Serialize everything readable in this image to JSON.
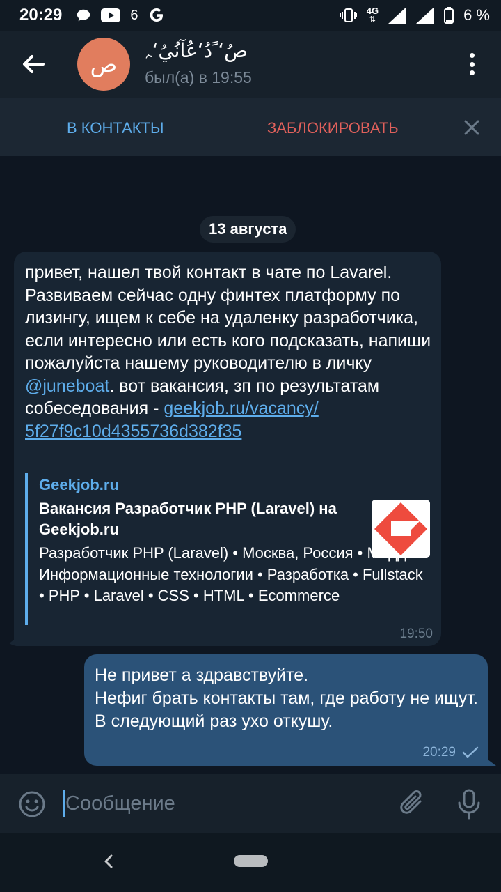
{
  "status_bar": {
    "time": "20:29",
    "notif_count": "6",
    "network": "4G",
    "battery_pct": "6 %",
    "icons": [
      "message-icon",
      "youtube-icon",
      "google-icon",
      "vibrate-icon",
      "signal-icon",
      "battery-icon"
    ]
  },
  "header": {
    "avatar_letter": "ص",
    "contact_name": "صُ‘ﹰدُ‘عُآنُيُ‘ﮧ",
    "last_seen": "был(а) в 19:55"
  },
  "actions": {
    "add_contact": "В КОНТАКТЫ",
    "block": "ЗАБЛОКИРОВАТЬ"
  },
  "chat": {
    "date": "13 августа",
    "incoming": {
      "text_1": "привет, нашел твой контакт в чате по Lavarel. Развиваем сейчас одну финтех платформу по лизингу, ищем к себе на удаленку разработчика, если интересно или есть кого подсказать, напиши пожалуйста нашему руководителю в личку ",
      "mention": "@juneboat",
      "text_2": ". вот вакансия, зп по результатам собеседования - ",
      "url_part_1": "geekjob.ru/vacancy/",
      "url_part_2": "5f27f9c10d4355736d382f35",
      "preview_site": "Geekjob.ru",
      "preview_title": "Вакансия Разработчик PHP (Laravel) на Geekjob.ru",
      "preview_desc": "Разработчик PHP (Laravel) • Москва, Россия • Миддл • Информационные технологии • Разработка • Fullstack • PHP • Laravel • CSS • HTML • Ecommerce",
      "time": "19:50"
    },
    "outgoing": {
      "line_1": "Не привет а здравствуйте.",
      "line_2": "Нефиг брать контакты там, где работу не ищут.",
      "line_3": "В следующий раз ухо откушу.",
      "time": "20:29"
    }
  },
  "input": {
    "placeholder": "Сообщение"
  },
  "colors": {
    "accent": "#5eadeb",
    "danger": "#e0605b",
    "bubble_in": "#182533",
    "bubble_out": "#2b5278",
    "background": "#0e1621"
  }
}
